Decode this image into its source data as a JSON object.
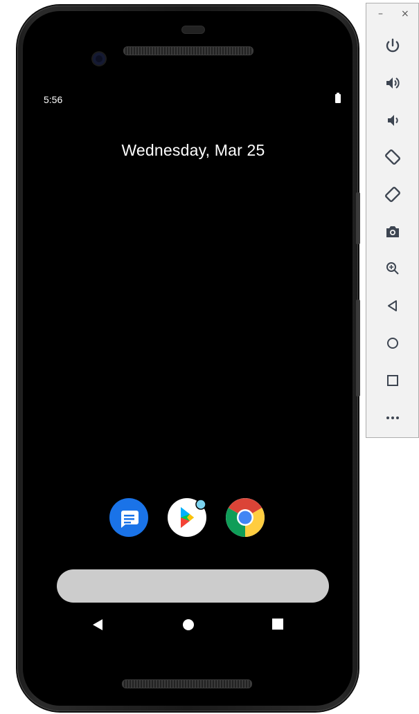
{
  "emulator": {
    "status_bar": {
      "time": "5:56",
      "battery_icon": "battery-full-icon"
    },
    "lock_screen": {
      "date": "Wednesday, Mar 25"
    },
    "dock_apps": [
      {
        "name": "Messages",
        "icon": "messages-icon",
        "color": "#1a73e8"
      },
      {
        "name": "Play Store",
        "icon": "play-store-icon",
        "color": "#ffffff"
      },
      {
        "name": "Chrome",
        "icon": "chrome-icon",
        "color": "#4285f4"
      }
    ],
    "search_bar": {
      "icon": "search-bar"
    },
    "nav_bar": [
      "back-icon",
      "home-icon",
      "recents-icon"
    ]
  },
  "side_panel": {
    "window_controls": {
      "minimize": "–",
      "close": "×"
    },
    "tools": [
      "power-icon",
      "volume-up-icon",
      "volume-down-icon",
      "rotate-left-icon",
      "rotate-right-icon",
      "screenshot-icon",
      "zoom-icon",
      "back-icon",
      "home-icon",
      "overview-icon",
      "more-icon"
    ]
  },
  "colors": {
    "panel_icon": "#3d4551",
    "screen_bg": "#000000",
    "search_bar": "#cccccc"
  }
}
